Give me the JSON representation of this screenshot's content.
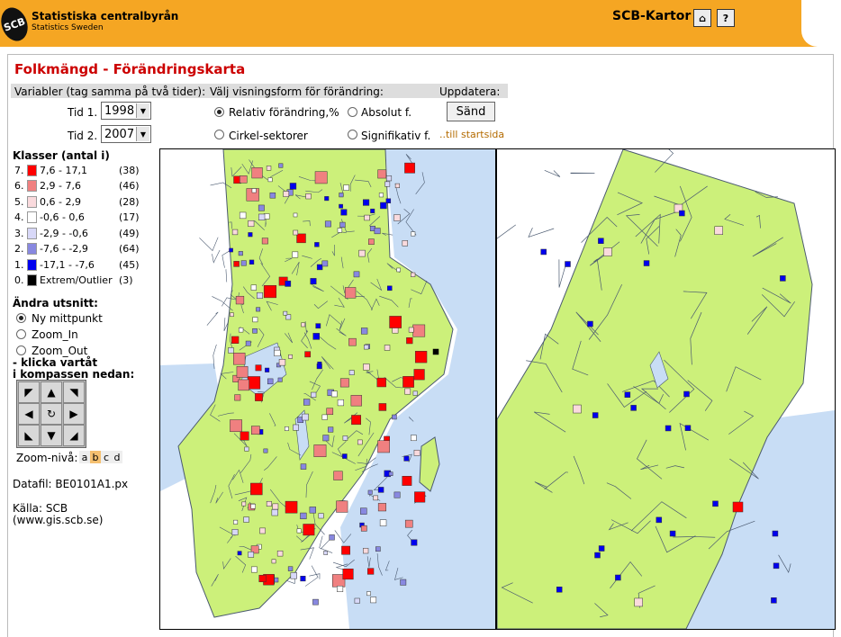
{
  "header": {
    "logo_text": "SCB",
    "org_name": "Statistiska centralbyrån",
    "org_sub": "Statistics Sweden",
    "app_name": "SCB-Kartor",
    "brand_color": "#f5a623"
  },
  "page_title": "Folkmängd  -  Förändringskarta",
  "controls": {
    "variables_label": "Variabler (tag samma på två tider):",
    "display_label": "Välj visningsform för förändring:",
    "update_label": "Uppdatera:",
    "tid1_label": "Tid 1.",
    "tid1_value": "1998",
    "tid2_label": "Tid 2.",
    "tid2_value": "2007",
    "radio_relative": "Relativ förändring,%",
    "radio_absolute": "Absolut f.",
    "radio_circle": "Cirkel-sektorer",
    "radio_significant": "Signifikativ f.",
    "send_button": "Sänd",
    "start_link": "..till startsida"
  },
  "legend": {
    "title": "Klasser (antal i)",
    "classes": [
      {
        "num": "7.",
        "range": "7,6 - 17,1",
        "count": "(38)",
        "color": "#ff0000"
      },
      {
        "num": "6.",
        "range": "2,9 - 7,6",
        "count": "(46)",
        "color": "#f08080"
      },
      {
        "num": "5.",
        "range": "0,6 - 2,9",
        "count": "(28)",
        "color": "#fadadd"
      },
      {
        "num": "4.",
        "range": "-0,6 - 0,6",
        "count": "(17)",
        "color": "#ffffff"
      },
      {
        "num": "3.",
        "range": "-2,9 - -0,6",
        "count": "(49)",
        "color": "#d8d8f8"
      },
      {
        "num": "2.",
        "range": "-7,6 - -2,9",
        "count": "(64)",
        "color": "#8888e0"
      },
      {
        "num": "1.",
        "range": "-17,1 - -7,6",
        "count": "(45)",
        "color": "#0000ee"
      },
      {
        "num": "0.",
        "range": "Extrem/Outlier",
        "count": "(3)",
        "color": "#000000"
      }
    ]
  },
  "nav": {
    "title": "Ändra utsnitt:",
    "opt_center": "Ny mittpunkt",
    "opt_zoom_in": "Zoom_In",
    "opt_zoom_out": "Zoom_Out",
    "compass_hint_1": "- klicka vartåt",
    "compass_hint_2": "i kompassen nedan:",
    "zoom_label": "Zoom-nivå:",
    "zoom_levels": [
      "a",
      "b",
      "c",
      "d"
    ],
    "zoom_selected": "b"
  },
  "datafile": "Datafil:  BE0101A1.px",
  "source_line1": "Källa: SCB",
  "source_line2": "(www.gis.scb.se)",
  "map_colors": {
    "land": "#ccf07a",
    "water": "#c8ddf5",
    "border": "#4b5a70"
  }
}
